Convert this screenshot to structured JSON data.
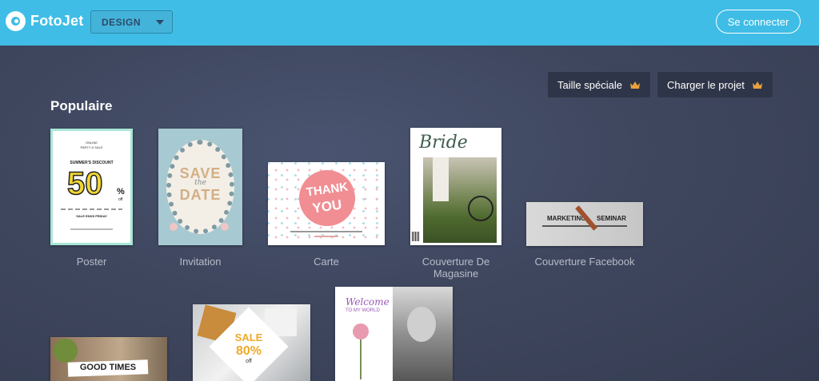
{
  "app": {
    "logo_text": "FotoJet"
  },
  "header": {
    "mode_select": "DESIGN",
    "connect_label": "Se connecter"
  },
  "actions": [
    {
      "label": "Taille spéciale"
    },
    {
      "label": "Charger le projet"
    }
  ],
  "section": {
    "title": "Populaire"
  },
  "templates": [
    {
      "label": "Poster"
    },
    {
      "label": "Invitation"
    },
    {
      "label": "Carte"
    },
    {
      "label": "Couverture De Magasine"
    },
    {
      "label": "Couverture Facebook"
    }
  ],
  "thumbs": {
    "poster": {
      "top": "ONLINE",
      "top2": "PARTY & SALE",
      "subtitle": "SUMMER'S DISCOUNT",
      "big": "50",
      "pct": "%",
      "off": "off",
      "line": "SALE ENDS FRIDAY"
    },
    "invitation": {
      "save": "SAVE",
      "the": "the",
      "date": "DATE"
    },
    "carte": {
      "thank": "THANK",
      "you": "YOU"
    },
    "magazine": {
      "title": "Bride"
    },
    "facebook": {
      "left": "MARKETING",
      "right": "SEMINAR"
    },
    "good_times": {
      "text": "GOOD TIMES"
    },
    "sale": {
      "sale": "SALE",
      "pct": "80%",
      "off": "off"
    },
    "welcome": {
      "line1": "Welcome",
      "line2": "TO MY WORLD"
    }
  },
  "colors": {
    "topbar": "#3fbde6",
    "background": "#3f475f",
    "crown": "#e8a23c"
  }
}
